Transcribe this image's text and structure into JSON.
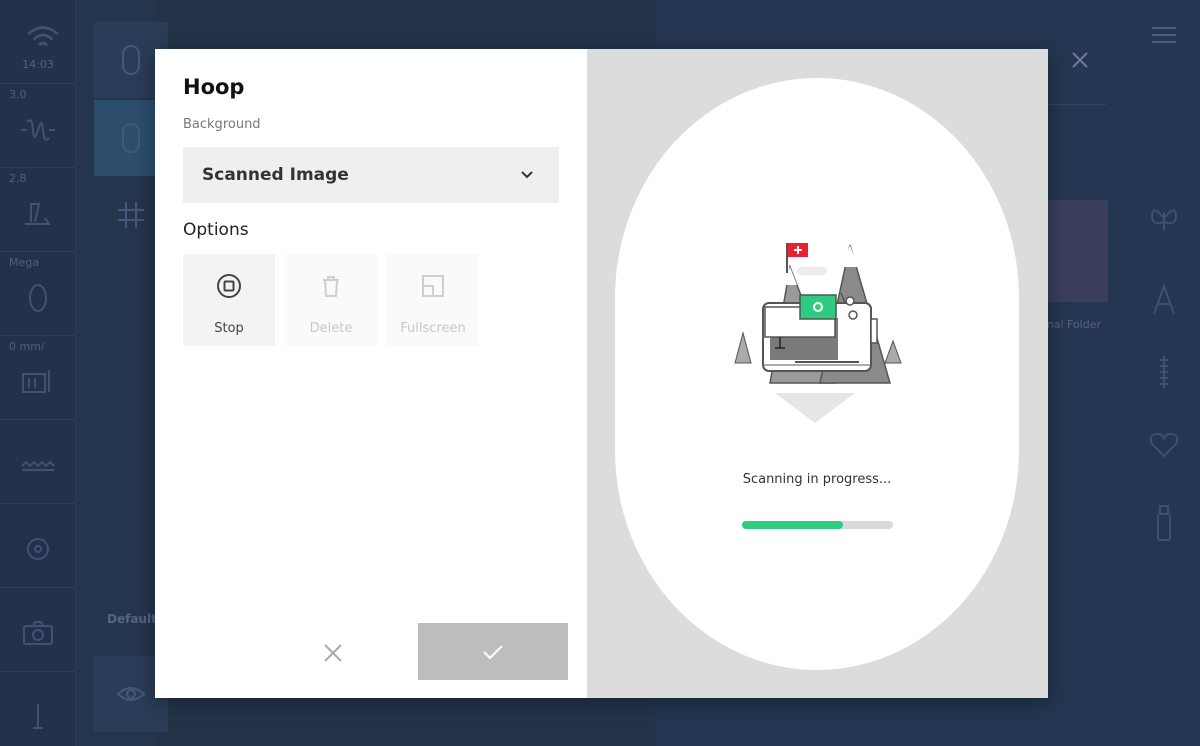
{
  "background_app": {
    "rail": [
      {
        "label": "",
        "time": "14:03",
        "icon": "wifi-icon"
      },
      {
        "label": "3.0",
        "time": "",
        "icon": "stitch-width-icon"
      },
      {
        "label": "2.8",
        "time": "",
        "icon": "stitch-length-icon"
      },
      {
        "label": "Mega",
        "time": "",
        "icon": "presser-foot-icon"
      },
      {
        "label": "0 mm/",
        "time": "",
        "icon": "feed-icon"
      },
      {
        "label": "",
        "time": "",
        "icon": "zigzag-icon"
      },
      {
        "label": "",
        "time": "",
        "icon": "bobbin-icon"
      },
      {
        "label": "",
        "time": "",
        "icon": "camera-icon"
      },
      {
        "label": "",
        "time": "",
        "icon": "needle-icon"
      }
    ],
    "default_label": "Default",
    "folder_label": "onal Folder"
  },
  "modal": {
    "title": "Hoop",
    "background_caption": "Background",
    "background_value": "Scanned Image",
    "options_title": "Options",
    "options": [
      {
        "label": "Stop",
        "icon": "stop-icon",
        "enabled": true
      },
      {
        "label": "Delete",
        "icon": "trash-icon",
        "enabled": false
      },
      {
        "label": "Fullscreen",
        "icon": "fullscreen-icon",
        "enabled": false
      }
    ],
    "status_text": "Scanning in progress...",
    "progress": 0.67,
    "colors": {
      "progress_fill": "#2ecc80",
      "confirm_button": "#bdbdbd",
      "flag": "#e8212e"
    }
  }
}
